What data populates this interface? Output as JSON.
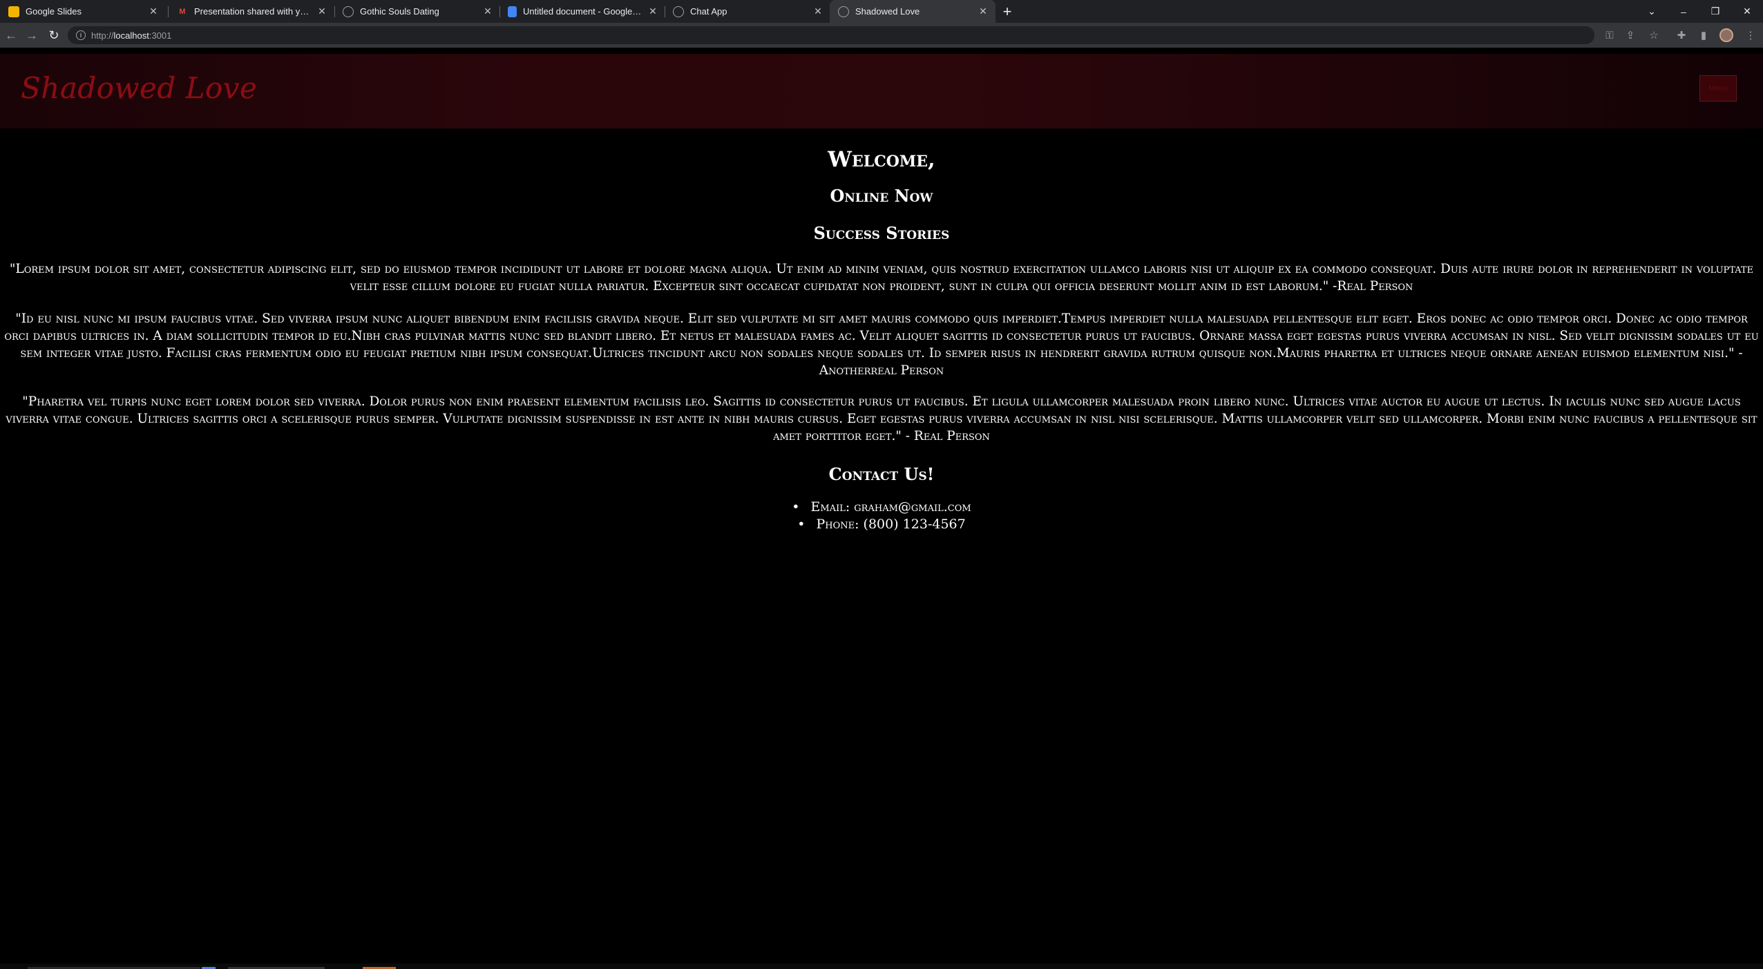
{
  "browser": {
    "tabs": [
      {
        "title": "Google Slides",
        "favicon": "slides-icon",
        "color": "#f4b400"
      },
      {
        "title": "Presentation shared with you: \"S",
        "favicon": "gmail-icon",
        "color": "#ea4335"
      },
      {
        "title": "Gothic Souls Dating",
        "favicon": "globe-icon",
        "color": "#5f6368"
      },
      {
        "title": "Untitled document - Google Doc",
        "favicon": "docs-icon",
        "color": "#4285f4"
      },
      {
        "title": "Chat App",
        "favicon": "globe-icon",
        "color": "#5f6368"
      },
      {
        "title": "Shadowed Love",
        "favicon": "globe-icon",
        "color": "#5f6368",
        "active": true
      }
    ],
    "url_scheme": "http://",
    "url_host": "localhost",
    "url_port": ":3001"
  },
  "site": {
    "logo": "Shadowed Love",
    "menu_button": "Menu"
  },
  "content": {
    "welcome": "Welcome,",
    "online_now": "Online Now",
    "success_stories": "Success Stories",
    "stories": [
      "\"Lorem ipsum dolor sit amet, consectetur adipiscing elit, sed do eiusmod tempor incididunt ut labore et dolore magna aliqua. Ut enim ad minim veniam, quis nostrud exercitation ullamco laboris nisi ut aliquip ex ea commodo consequat. Duis aute irure dolor in reprehenderit in voluptate velit esse cillum dolore eu fugiat nulla pariatur. Excepteur sint occaecat cupidatat non proident, sunt in culpa qui officia deserunt mollit anim id est laborum.\" -Real Person",
      "\"Id eu nisl nunc mi ipsum faucibus vitae. Sed viverra ipsum nunc aliquet bibendum enim facilisis gravida neque. Elit sed vulputate mi sit amet mauris commodo quis imperdiet.Tempus imperdiet nulla malesuada pellentesque elit eget. Eros donec ac odio tempor orci. Donec ac odio tempor orci dapibus ultrices in. A diam sollicitudin tempor id eu.Nibh cras pulvinar mattis nunc sed blandit libero. Et netus et malesuada fames ac. Velit aliquet sagittis id consectetur purus ut faucibus. Ornare massa eget egestas purus viverra accumsan in nisl. Sed velit dignissim sodales ut eu sem integer vitae justo. Facilisi cras fermentum odio eu feugiat pretium nibh ipsum consequat.Ultrices tincidunt arcu non sodales neque sodales ut. Id semper risus in hendrerit gravida rutrum quisque non.Mauris pharetra et ultrices neque ornare aenean euismod elementum nisi.\" -Anotherreal Person",
      "\"Pharetra vel turpis nunc eget lorem dolor sed viverra. Dolor purus non enim praesent elementum facilisis leo. Sagittis id consectetur purus ut faucibus. Et ligula ullamcorper malesuada proin libero nunc. Ultrices vitae auctor eu augue ut lectus. In iaculis nunc sed augue lacus viverra vitae congue. Ultrices sagittis orci a scelerisque purus semper. Vulputate dignissim suspendisse in est ante in nibh mauris cursus. Eget egestas purus viverra accumsan in nisl nisi scelerisque. Mattis ullamcorper velit sed ullamcorper. Morbi enim nunc faucibus a pellentesque sit amet porttitor eget.\" - Real Person"
    ],
    "contact_heading": "Contact Us!",
    "contact_email": "Email: graham@gmail.com",
    "contact_phone": "Phone: (800) 123-4567"
  }
}
